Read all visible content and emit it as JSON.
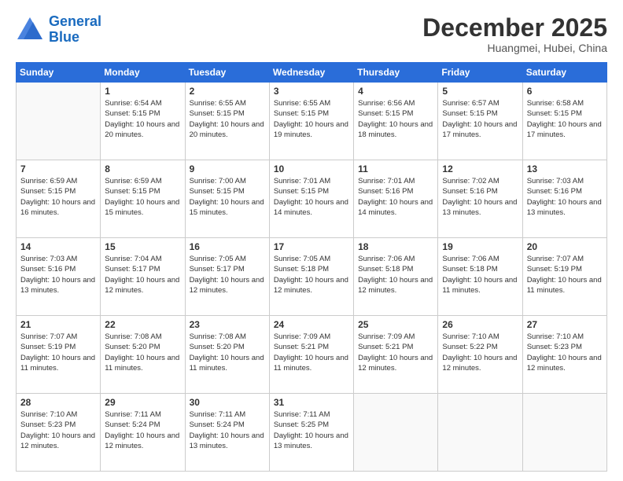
{
  "logo": {
    "line1": "General",
    "line2": "Blue"
  },
  "title": "December 2025",
  "subtitle": "Huangmei, Hubei, China",
  "weekdays": [
    "Sunday",
    "Monday",
    "Tuesday",
    "Wednesday",
    "Thursday",
    "Friday",
    "Saturday"
  ],
  "weeks": [
    [
      {
        "day": "",
        "sunrise": "",
        "sunset": "",
        "daylight": ""
      },
      {
        "day": "1",
        "sunrise": "Sunrise: 6:54 AM",
        "sunset": "Sunset: 5:15 PM",
        "daylight": "Daylight: 10 hours and 20 minutes."
      },
      {
        "day": "2",
        "sunrise": "Sunrise: 6:55 AM",
        "sunset": "Sunset: 5:15 PM",
        "daylight": "Daylight: 10 hours and 20 minutes."
      },
      {
        "day": "3",
        "sunrise": "Sunrise: 6:55 AM",
        "sunset": "Sunset: 5:15 PM",
        "daylight": "Daylight: 10 hours and 19 minutes."
      },
      {
        "day": "4",
        "sunrise": "Sunrise: 6:56 AM",
        "sunset": "Sunset: 5:15 PM",
        "daylight": "Daylight: 10 hours and 18 minutes."
      },
      {
        "day": "5",
        "sunrise": "Sunrise: 6:57 AM",
        "sunset": "Sunset: 5:15 PM",
        "daylight": "Daylight: 10 hours and 17 minutes."
      },
      {
        "day": "6",
        "sunrise": "Sunrise: 6:58 AM",
        "sunset": "Sunset: 5:15 PM",
        "daylight": "Daylight: 10 hours and 17 minutes."
      }
    ],
    [
      {
        "day": "7",
        "sunrise": "Sunrise: 6:59 AM",
        "sunset": "Sunset: 5:15 PM",
        "daylight": "Daylight: 10 hours and 16 minutes."
      },
      {
        "day": "8",
        "sunrise": "Sunrise: 6:59 AM",
        "sunset": "Sunset: 5:15 PM",
        "daylight": "Daylight: 10 hours and 15 minutes."
      },
      {
        "day": "9",
        "sunrise": "Sunrise: 7:00 AM",
        "sunset": "Sunset: 5:15 PM",
        "daylight": "Daylight: 10 hours and 15 minutes."
      },
      {
        "day": "10",
        "sunrise": "Sunrise: 7:01 AM",
        "sunset": "Sunset: 5:15 PM",
        "daylight": "Daylight: 10 hours and 14 minutes."
      },
      {
        "day": "11",
        "sunrise": "Sunrise: 7:01 AM",
        "sunset": "Sunset: 5:16 PM",
        "daylight": "Daylight: 10 hours and 14 minutes."
      },
      {
        "day": "12",
        "sunrise": "Sunrise: 7:02 AM",
        "sunset": "Sunset: 5:16 PM",
        "daylight": "Daylight: 10 hours and 13 minutes."
      },
      {
        "day": "13",
        "sunrise": "Sunrise: 7:03 AM",
        "sunset": "Sunset: 5:16 PM",
        "daylight": "Daylight: 10 hours and 13 minutes."
      }
    ],
    [
      {
        "day": "14",
        "sunrise": "Sunrise: 7:03 AM",
        "sunset": "Sunset: 5:16 PM",
        "daylight": "Daylight: 10 hours and 13 minutes."
      },
      {
        "day": "15",
        "sunrise": "Sunrise: 7:04 AM",
        "sunset": "Sunset: 5:17 PM",
        "daylight": "Daylight: 10 hours and 12 minutes."
      },
      {
        "day": "16",
        "sunrise": "Sunrise: 7:05 AM",
        "sunset": "Sunset: 5:17 PM",
        "daylight": "Daylight: 10 hours and 12 minutes."
      },
      {
        "day": "17",
        "sunrise": "Sunrise: 7:05 AM",
        "sunset": "Sunset: 5:18 PM",
        "daylight": "Daylight: 10 hours and 12 minutes."
      },
      {
        "day": "18",
        "sunrise": "Sunrise: 7:06 AM",
        "sunset": "Sunset: 5:18 PM",
        "daylight": "Daylight: 10 hours and 12 minutes."
      },
      {
        "day": "19",
        "sunrise": "Sunrise: 7:06 AM",
        "sunset": "Sunset: 5:18 PM",
        "daylight": "Daylight: 10 hours and 11 minutes."
      },
      {
        "day": "20",
        "sunrise": "Sunrise: 7:07 AM",
        "sunset": "Sunset: 5:19 PM",
        "daylight": "Daylight: 10 hours and 11 minutes."
      }
    ],
    [
      {
        "day": "21",
        "sunrise": "Sunrise: 7:07 AM",
        "sunset": "Sunset: 5:19 PM",
        "daylight": "Daylight: 10 hours and 11 minutes."
      },
      {
        "day": "22",
        "sunrise": "Sunrise: 7:08 AM",
        "sunset": "Sunset: 5:20 PM",
        "daylight": "Daylight: 10 hours and 11 minutes."
      },
      {
        "day": "23",
        "sunrise": "Sunrise: 7:08 AM",
        "sunset": "Sunset: 5:20 PM",
        "daylight": "Daylight: 10 hours and 11 minutes."
      },
      {
        "day": "24",
        "sunrise": "Sunrise: 7:09 AM",
        "sunset": "Sunset: 5:21 PM",
        "daylight": "Daylight: 10 hours and 11 minutes."
      },
      {
        "day": "25",
        "sunrise": "Sunrise: 7:09 AM",
        "sunset": "Sunset: 5:21 PM",
        "daylight": "Daylight: 10 hours and 12 minutes."
      },
      {
        "day": "26",
        "sunrise": "Sunrise: 7:10 AM",
        "sunset": "Sunset: 5:22 PM",
        "daylight": "Daylight: 10 hours and 12 minutes."
      },
      {
        "day": "27",
        "sunrise": "Sunrise: 7:10 AM",
        "sunset": "Sunset: 5:23 PM",
        "daylight": "Daylight: 10 hours and 12 minutes."
      }
    ],
    [
      {
        "day": "28",
        "sunrise": "Sunrise: 7:10 AM",
        "sunset": "Sunset: 5:23 PM",
        "daylight": "Daylight: 10 hours and 12 minutes."
      },
      {
        "day": "29",
        "sunrise": "Sunrise: 7:11 AM",
        "sunset": "Sunset: 5:24 PM",
        "daylight": "Daylight: 10 hours and 12 minutes."
      },
      {
        "day": "30",
        "sunrise": "Sunrise: 7:11 AM",
        "sunset": "Sunset: 5:24 PM",
        "daylight": "Daylight: 10 hours and 13 minutes."
      },
      {
        "day": "31",
        "sunrise": "Sunrise: 7:11 AM",
        "sunset": "Sunset: 5:25 PM",
        "daylight": "Daylight: 10 hours and 13 minutes."
      },
      {
        "day": "",
        "sunrise": "",
        "sunset": "",
        "daylight": ""
      },
      {
        "day": "",
        "sunrise": "",
        "sunset": "",
        "daylight": ""
      },
      {
        "day": "",
        "sunrise": "",
        "sunset": "",
        "daylight": ""
      }
    ]
  ]
}
